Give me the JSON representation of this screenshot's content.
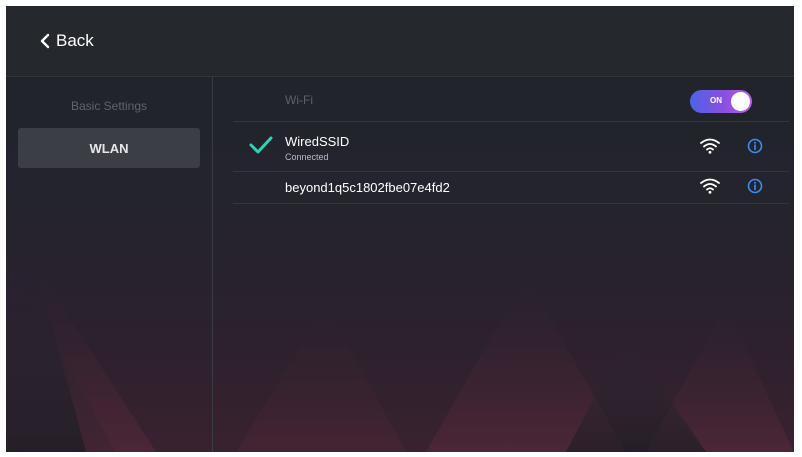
{
  "header": {
    "back_label": "Back"
  },
  "sidebar": {
    "heading": "Basic Settings",
    "items": [
      {
        "label": "WLAN",
        "selected": true
      }
    ]
  },
  "wifi": {
    "label": "Wi-Fi",
    "toggle_text": "ON",
    "enabled": true
  },
  "networks": [
    {
      "ssid": "WiredSSID",
      "status": "Connected",
      "connected": true,
      "signal_icon": "wifi-signal-icon",
      "info_icon": "info-icon"
    },
    {
      "ssid": "beyond1q5c1802fbe07e4fd2",
      "status": "",
      "connected": false,
      "signal_icon": "wifi-signal-icon",
      "info_icon": "info-icon"
    }
  ],
  "colors": {
    "accent_check": "#2fd3b2",
    "info_blue": "#3d8cf0",
    "toggle_start": "#4d63e6",
    "toggle_end": "#c35ee8"
  }
}
